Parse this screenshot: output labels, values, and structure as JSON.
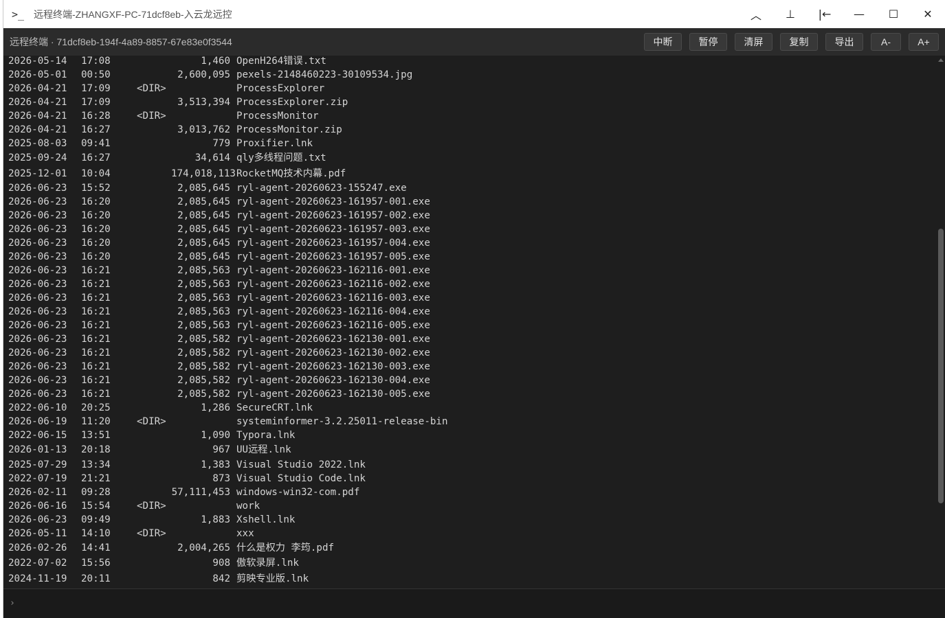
{
  "window": {
    "title": "远程终端-ZHANGXF-PC-71dcf8eb-入云龙远控",
    "icon": "terminal-icon",
    "controls": [
      {
        "name": "collapse-button",
        "glyph": "︿"
      },
      {
        "name": "pin-button",
        "glyph": "⊥"
      },
      {
        "name": "dock-left-button",
        "glyph": "|←"
      },
      {
        "name": "minimize-button",
        "glyph": "—"
      },
      {
        "name": "maximize-button",
        "glyph": "☐"
      },
      {
        "name": "close-button",
        "glyph": "✕"
      }
    ]
  },
  "toolbar": {
    "session_label": "远程终端 · 71dcf8eb-194f-4a89-8857-67e83e0f3544",
    "buttons": [
      {
        "name": "interrupt-button",
        "label": "中断"
      },
      {
        "name": "pause-button",
        "label": "暂停"
      },
      {
        "name": "clear-button",
        "label": "清屏"
      },
      {
        "name": "copy-button",
        "label": "复制"
      },
      {
        "name": "export-button",
        "label": "导出"
      },
      {
        "name": "font-smaller-button",
        "label": "A-"
      },
      {
        "name": "font-larger-button",
        "label": "A+"
      }
    ]
  },
  "terminal": {
    "lines": [
      {
        "date": "2026-05-14",
        "time": "17:08",
        "dir": "",
        "size": "1,460",
        "name": "OpenH264错误.txt"
      },
      {
        "date": "2026-05-01",
        "time": "00:50",
        "dir": "",
        "size": "2,600,095",
        "name": "pexels-2148460223-30109534.jpg"
      },
      {
        "date": "2026-04-21",
        "time": "17:09",
        "dir": "<DIR>",
        "size": "",
        "name": "ProcessExplorer"
      },
      {
        "date": "2026-04-21",
        "time": "17:09",
        "dir": "",
        "size": "3,513,394",
        "name": "ProcessExplorer.zip"
      },
      {
        "date": "2026-04-21",
        "time": "16:28",
        "dir": "<DIR>",
        "size": "",
        "name": "ProcessMonitor"
      },
      {
        "date": "2026-04-21",
        "time": "16:27",
        "dir": "",
        "size": "3,013,762",
        "name": "ProcessMonitor.zip"
      },
      {
        "date": "2025-08-03",
        "time": "09:41",
        "dir": "",
        "size": "779",
        "name": "Proxifier.lnk"
      },
      {
        "date": "2025-09-24",
        "time": "16:27",
        "dir": "",
        "size": "34,614",
        "name": "qly多线程问题.txt",
        "tall": true
      },
      {
        "date": "2025-12-01",
        "time": "10:04",
        "dir": "",
        "size": "174,018,113",
        "name": "RocketMQ技术内幕.pdf",
        "tall": true
      },
      {
        "date": "2026-06-23",
        "time": "15:52",
        "dir": "",
        "size": "2,085,645",
        "name": "ryl-agent-20260623-155247.exe"
      },
      {
        "date": "2026-06-23",
        "time": "16:20",
        "dir": "",
        "size": "2,085,645",
        "name": "ryl-agent-20260623-161957-001.exe"
      },
      {
        "date": "2026-06-23",
        "time": "16:20",
        "dir": "",
        "size": "2,085,645",
        "name": "ryl-agent-20260623-161957-002.exe"
      },
      {
        "date": "2026-06-23",
        "time": "16:20",
        "dir": "",
        "size": "2,085,645",
        "name": "ryl-agent-20260623-161957-003.exe"
      },
      {
        "date": "2026-06-23",
        "time": "16:20",
        "dir": "",
        "size": "2,085,645",
        "name": "ryl-agent-20260623-161957-004.exe"
      },
      {
        "date": "2026-06-23",
        "time": "16:20",
        "dir": "",
        "size": "2,085,645",
        "name": "ryl-agent-20260623-161957-005.exe"
      },
      {
        "date": "2026-06-23",
        "time": "16:21",
        "dir": "",
        "size": "2,085,563",
        "name": "ryl-agent-20260623-162116-001.exe"
      },
      {
        "date": "2026-06-23",
        "time": "16:21",
        "dir": "",
        "size": "2,085,563",
        "name": "ryl-agent-20260623-162116-002.exe"
      },
      {
        "date": "2026-06-23",
        "time": "16:21",
        "dir": "",
        "size": "2,085,563",
        "name": "ryl-agent-20260623-162116-003.exe"
      },
      {
        "date": "2026-06-23",
        "time": "16:21",
        "dir": "",
        "size": "2,085,563",
        "name": "ryl-agent-20260623-162116-004.exe"
      },
      {
        "date": "2026-06-23",
        "time": "16:21",
        "dir": "",
        "size": "2,085,563",
        "name": "ryl-agent-20260623-162116-005.exe"
      },
      {
        "date": "2026-06-23",
        "time": "16:21",
        "dir": "",
        "size": "2,085,582",
        "name": "ryl-agent-20260623-162130-001.exe"
      },
      {
        "date": "2026-06-23",
        "time": "16:21",
        "dir": "",
        "size": "2,085,582",
        "name": "ryl-agent-20260623-162130-002.exe"
      },
      {
        "date": "2026-06-23",
        "time": "16:21",
        "dir": "",
        "size": "2,085,582",
        "name": "ryl-agent-20260623-162130-003.exe"
      },
      {
        "date": "2026-06-23",
        "time": "16:21",
        "dir": "",
        "size": "2,085,582",
        "name": "ryl-agent-20260623-162130-004.exe"
      },
      {
        "date": "2026-06-23",
        "time": "16:21",
        "dir": "",
        "size": "2,085,582",
        "name": "ryl-agent-20260623-162130-005.exe"
      },
      {
        "date": "2022-06-10",
        "time": "20:25",
        "dir": "",
        "size": "1,286",
        "name": "SecureCRT.lnk"
      },
      {
        "date": "2026-06-19",
        "time": "11:20",
        "dir": "<DIR>",
        "size": "",
        "name": "systeminformer-3.2.25011-release-bin"
      },
      {
        "date": "2022-06-15",
        "time": "13:51",
        "dir": "",
        "size": "1,090",
        "name": "Typora.lnk"
      },
      {
        "date": "2026-01-13",
        "time": "20:18",
        "dir": "",
        "size": "967",
        "name": "UU远程.lnk",
        "tall": true
      },
      {
        "date": "2025-07-29",
        "time": "13:34",
        "dir": "",
        "size": "1,383",
        "name": "Visual Studio 2022.lnk"
      },
      {
        "date": "2022-07-19",
        "time": "21:21",
        "dir": "",
        "size": "873",
        "name": "Visual Studio Code.lnk"
      },
      {
        "date": "2026-02-11",
        "time": "09:28",
        "dir": "",
        "size": "57,111,453",
        "name": "windows-win32-com.pdf"
      },
      {
        "date": "2026-06-16",
        "time": "15:54",
        "dir": "<DIR>",
        "size": "",
        "name": "work"
      },
      {
        "date": "2026-06-23",
        "time": "09:49",
        "dir": "",
        "size": "1,883",
        "name": "Xshell.lnk"
      },
      {
        "date": "2026-05-11",
        "time": "14:10",
        "dir": "<DIR>",
        "size": "",
        "name": "xxx"
      },
      {
        "date": "2026-02-26",
        "time": "14:41",
        "dir": "",
        "size": "2,004,265",
        "name": "什么是权力 李筠.pdf",
        "tall": true
      },
      {
        "date": "2022-07-02",
        "time": "15:56",
        "dir": "",
        "size": "908",
        "name": "傲软录屏.lnk",
        "tall": true
      },
      {
        "date": "2024-11-19",
        "time": "20:11",
        "dir": "",
        "size": "842",
        "name": "剪映专业版.lnk",
        "tall": true
      }
    ]
  },
  "input": {
    "prompt": "›",
    "value": ""
  }
}
